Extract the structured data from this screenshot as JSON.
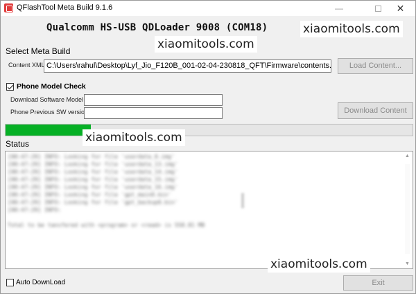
{
  "window": {
    "title": "QFlashTool Meta Build 9.1.6",
    "controls": {
      "minimize": "—",
      "maximize": "",
      "close": "✕"
    }
  },
  "device": {
    "name": "Qualcomm HS-USB QDLoader 9008 (COM18)"
  },
  "watermarks": [
    "xiaomitools.com",
    "xiaomitools.com",
    "xiaomitools.com",
    "xiaomitools.com"
  ],
  "meta_build": {
    "section_label": "Select Meta Build",
    "content_xml_label": "Content XML",
    "content_xml_value": "C:\\Users\\rahul\\Desktop\\Lyf_Jio_F120B_001-02-04-230818_QFT\\Firmware\\contents.xml",
    "load_button": "Load Content..."
  },
  "phone_model_check": {
    "label": "Phone Model Check",
    "checked": true,
    "download_model_label": "Download Software  Model :",
    "download_model_value": "",
    "previous_sw_label": "Phone Previous  SW version",
    "previous_sw_value": "",
    "download_button": "Download Content"
  },
  "progress": {
    "percent": 21,
    "color": "#06b025"
  },
  "status": {
    "label": "Status",
    "log_lines": [
      "[00:47:29] INFO: Looking for file 'userdata_0.img'",
      "[00:47:29] INFO: Looking for file 'userdata_13.img'",
      "[00:47:29] INFO: Looking for file 'userdata_14.img'",
      "[00:47:29] INFO: Looking for file 'userdata_15.img'",
      "[00:47:29] INFO: Looking for file 'userdata_16.img'",
      "[00:47:29] INFO: Looking for file 'gpt_main0.bin'",
      "[00:47:29] INFO: Looking for file 'gpt_backup0.bin'",
      "[00:47:29] INFO: ",
      "",
      "Total to be tansfered with <program> or <read> is 558.81 MB"
    ]
  },
  "footer": {
    "auto_download_label": "Auto DownLoad",
    "auto_download_checked": false,
    "exit_button": "Exit"
  }
}
